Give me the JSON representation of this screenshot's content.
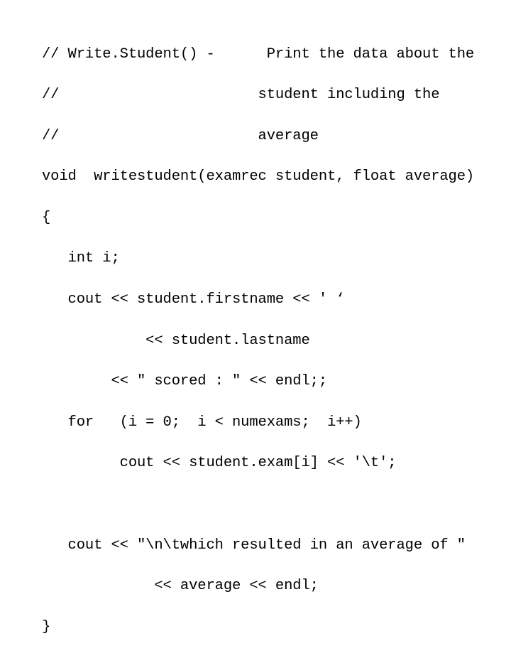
{
  "slide": {
    "background_color": "#ffffff",
    "text_color": "#000000",
    "title": "WriteStudent() code listing",
    "language": "C++"
  },
  "code": {
    "lines": [
      "// Write.Student() -      Print the data about the",
      "//                       student including the",
      "//                       average",
      "void  writestudent(examrec student, float average)",
      "{",
      "   int i;",
      "   cout << student.firstname << ' ‘",
      "            << student.lastname",
      "        << \" scored : \" << endl;;",
      "   for   (i = 0;  i < numexams;  i++)",
      "         cout << student.exam[i] << '\\t';",
      "",
      "   cout << \"\\n\\twhich resulted in an average of \"",
      "             << average << endl;",
      "}"
    ]
  }
}
